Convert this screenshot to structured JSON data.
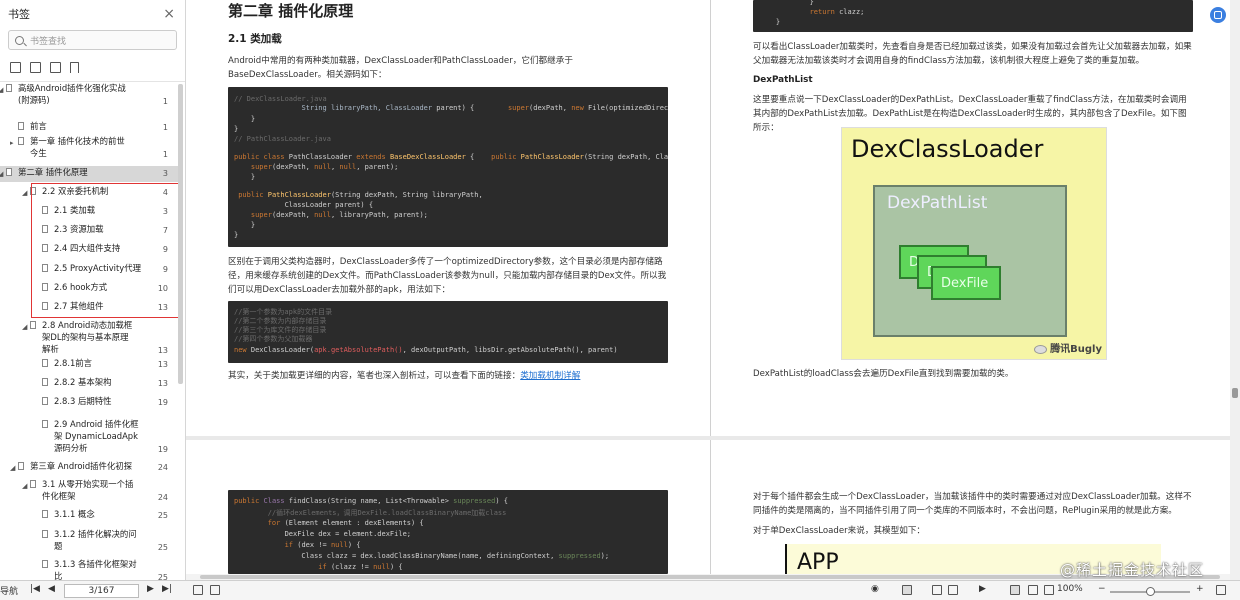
{
  "sidebar": {
    "title": "书签",
    "search_placeholder": "书签查找",
    "items": [
      {
        "label": "高级Android插件化强化实战\n(附源码)",
        "page": "1",
        "arrow": "◢"
      },
      {
        "label": "前言",
        "page": "1",
        "arrow": ""
      },
      {
        "label": "第一章 插件化技术的前世\n今生",
        "page": "1",
        "arrow": "▸"
      },
      {
        "label": "第二章 插件化原理",
        "page": "3",
        "arrow": "◢"
      },
      {
        "label": "2.2 双亲委托机制",
        "page": "4",
        "arrow": "◢"
      },
      {
        "label": "2.1 类加载",
        "page": "3",
        "arrow": ""
      },
      {
        "label": "2.3 资源加载",
        "page": "7",
        "arrow": ""
      },
      {
        "label": "2.4 四大组件支持",
        "page": "9",
        "arrow": ""
      },
      {
        "label": "2.5 ProxyActivity代理",
        "page": "9",
        "arrow": ""
      },
      {
        "label": "2.6 hook方式",
        "page": "10",
        "arrow": ""
      },
      {
        "label": "2.7 其他组件",
        "page": "13",
        "arrow": ""
      },
      {
        "label": "2.8 Android动态加载框\n架DL的架构与基本原理\n解析",
        "page": "13",
        "arrow": "◢"
      },
      {
        "label": "2.8.1前言",
        "page": "13",
        "arrow": ""
      },
      {
        "label": "2.8.2 基本架构",
        "page": "13",
        "arrow": ""
      },
      {
        "label": "2.8.3 后期特性",
        "page": "19",
        "arrow": ""
      },
      {
        "label": "2.9 Android 插件化框\n架 DynamicLoadApk\n源码分析",
        "page": "19",
        "arrow": ""
      },
      {
        "label": "第三章 Android插件化初探",
        "page": "24",
        "arrow": "◢"
      },
      {
        "label": "3.1 从零开始实现一个插\n件化框架",
        "page": "24",
        "arrow": "◢"
      },
      {
        "label": "3.1.1 概念",
        "page": "25",
        "arrow": ""
      },
      {
        "label": "3.1.2 插件化解决的问\n题",
        "page": "25",
        "arrow": ""
      },
      {
        "label": "3.1.3 各插件化框架对\n比",
        "page": "25",
        "arrow": ""
      }
    ]
  },
  "page1": {
    "chapter_title": "第二章 插件化原理",
    "section_title": "2.1 类加载",
    "para1": "Android中常用的有两种类加载器，DexClassLoader和PathClassLoader，它们都继承于BaseDexClassLoader。相关源码如下：",
    "para2": "区别在于调用父类构造器时，DexClassLoader多传了一个optimizedDirectory参数，这个目录必须是内部存储路径，用来缓存系统创建的Dex文件。而PathClassLoader该参数为null，只能加载内部存储目录的Dex文件。所以我们可以用DexClassLoader去加载外部的apk，用法如下：",
    "para3": "其实，关于类加载更详细的内容，笔者也深入剖析过，可以查看下面的链接：",
    "link": "类加载机制详解"
  },
  "page2": {
    "para1": "可以看出ClassLoader加载类时，先查看自身是否已经加载过该类，如果没有加载过会首先让父加载器去加载，如果父加载器无法加载该类时才会调用自身的findClass方法加载，该机制很大程度上避免了类的重复加载。",
    "heading": "DexPathList",
    "para2": "这里要重点说一下DexClassLoader的DexPathList。DexClassLoader重载了findClass方法，在加载类时会调用其内部的DexPathList去加载。DexPathList是在构造DexClassLoader时生成的，其内部包含了DexFile。如下图所示：",
    "figure": {
      "title": "DexClassLoader",
      "inner": "DexPathList",
      "file1": "DexFile",
      "file2": "DexFile",
      "file3": "DexFile",
      "watermark": "腾讯Bugly"
    },
    "para3": "DexPathList的loadClass会去遍历DexFile直到找到需要加载的类。"
  },
  "page4": {
    "para1": "对于每个插件都会生成一个DexClassLoader，当加载该插件中的类时需要通过对应DexClassLoader加载。这样不同插件的类是隔离的，当不同插件引用了同一个类库的不同版本时，不会出问题，RePlugin采用的就是此方案。",
    "para2": "对于单DexClassLoader来说，其模型如下：",
    "app_label": "APP"
  },
  "status": {
    "left_label": "导航",
    "page_value": "3/167",
    "zoom": "100%",
    "watermark": "@稀土掘金技术社区"
  }
}
